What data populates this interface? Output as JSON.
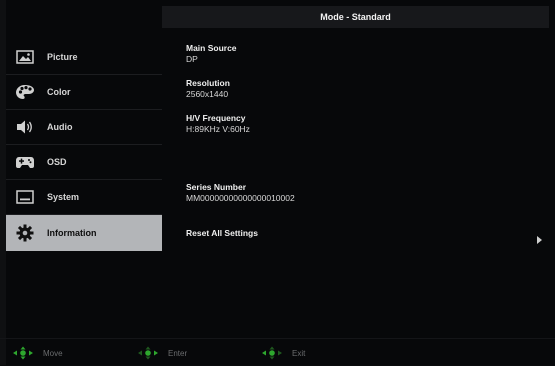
{
  "header": {
    "title": "Mode - Standard"
  },
  "sidebar": {
    "items": [
      {
        "label": "Picture",
        "icon": "picture-icon"
      },
      {
        "label": "Color",
        "icon": "palette-icon"
      },
      {
        "label": "Audio",
        "icon": "speaker-icon"
      },
      {
        "label": "OSD",
        "icon": "gamepad-icon"
      },
      {
        "label": "System",
        "icon": "monitor-icon"
      },
      {
        "label": "Information",
        "icon": "gear-icon",
        "active": true
      }
    ]
  },
  "info": {
    "main_source": {
      "label": "Main Source",
      "value": "DP"
    },
    "resolution": {
      "label": "Resolution",
      "value": "2560x1440"
    },
    "frequency": {
      "label": "H/V Frequency",
      "value": "H:89KHz V:60Hz"
    },
    "serial": {
      "label": "Series Number",
      "value": "MM00000000000000010002"
    },
    "reset": {
      "label": "Reset All Settings"
    }
  },
  "footer": {
    "move": "Move",
    "enter": "Enter",
    "exit": "Exit"
  },
  "colors": {
    "accent_green": "#2ea82e",
    "active_bg": "#b3b5b8"
  }
}
